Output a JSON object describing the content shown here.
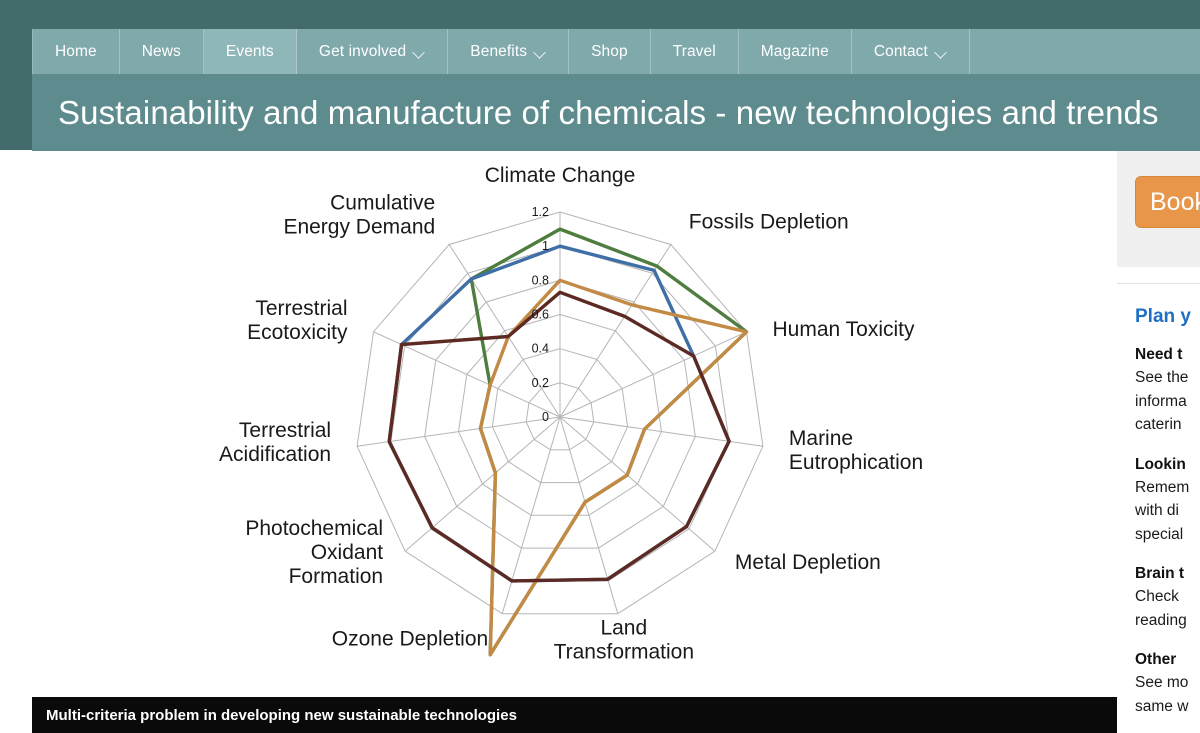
{
  "nav": {
    "items": [
      {
        "label": "Home",
        "has_dropdown": false,
        "active": false
      },
      {
        "label": "News",
        "has_dropdown": false,
        "active": false
      },
      {
        "label": "Events",
        "has_dropdown": false,
        "active": true
      },
      {
        "label": "Get involved",
        "has_dropdown": true,
        "active": false
      },
      {
        "label": "Benefits",
        "has_dropdown": true,
        "active": false
      },
      {
        "label": "Shop",
        "has_dropdown": false,
        "active": false
      },
      {
        "label": "Travel",
        "has_dropdown": false,
        "active": false
      },
      {
        "label": "Magazine",
        "has_dropdown": false,
        "active": false
      },
      {
        "label": "Contact",
        "has_dropdown": true,
        "active": false
      }
    ]
  },
  "header": {
    "title": "Sustainability and manufacture of chemicals - new technologies and trends"
  },
  "caption": {
    "text": "Multi-criteria problem in developing new sustainable technologies"
  },
  "sidebar": {
    "book_button_label": "Book",
    "card_title": "Plan y",
    "blocks": [
      {
        "heading": "Need t",
        "lines": [
          "See the",
          "informa",
          "caterin"
        ]
      },
      {
        "heading": "Lookin",
        "lines": [
          "Remem",
          "with di",
          "special"
        ]
      },
      {
        "heading": "Brain t",
        "lines": [
          "Check",
          "reading"
        ]
      },
      {
        "heading": "Other",
        "lines": [
          "See mo",
          "same w"
        ]
      }
    ]
  },
  "colors": {
    "nav_bg": "#7fa9ab",
    "nav_active_bg": "#8fb6b8",
    "title_bg": "#5e8c8e",
    "page_frame": "#436b6b",
    "caption_bg": "#0a0a0a",
    "book_button": "#e8974a",
    "link": "#2a7fd4",
    "card_title": "#1f6fc4",
    "series_green": "#4e7d3f",
    "series_blue": "#3f6fa6",
    "series_orange": "#c28a45",
    "series_brown": "#5c2a22",
    "grid": "#b5b5b5"
  },
  "chart_data": {
    "type": "radar",
    "title": "",
    "grid": true,
    "legend_position": "none",
    "rlim": [
      0,
      1.2
    ],
    "rticks": [
      "0",
      "0.2",
      "0.4",
      "0.6",
      "0.8",
      "1",
      "1.2"
    ],
    "rtick_values": [
      0,
      0.2,
      0.4,
      0.6,
      0.8,
      1.0,
      1.2
    ],
    "categories": [
      "Climate Change",
      "Fossils Depletion",
      "Human Toxicity",
      "Marine Eutrophication",
      "Metal Depletion",
      "Land Transformation",
      "Ozone Depletion",
      "Photochemical Oxidant Formation",
      "Terrestrial Acidification",
      "Terrestrial Ecotoxicity",
      "Cumulative Energy Demand"
    ],
    "series": [
      {
        "name": "series-green",
        "color": "#4e7d3f",
        "values": [
          1.1,
          1.05,
          1.2,
          0.5,
          0.52,
          0.52,
          1.45,
          0.5,
          0.47,
          0.45,
          0.96
        ]
      },
      {
        "name": "series-blue",
        "color": "#3f6fa6",
        "values": [
          1.0,
          1.02,
          0.86,
          1.0,
          0.98,
          0.99,
          1.0,
          0.99,
          1.01,
          1.02,
          0.96
        ]
      },
      {
        "name": "series-orange",
        "color": "#c28a45",
        "values": [
          0.8,
          0.78,
          1.2,
          0.5,
          0.52,
          0.52,
          1.45,
          0.5,
          0.47,
          0.45,
          0.56
        ]
      },
      {
        "name": "series-brown",
        "color": "#5c2a22",
        "values": [
          0.73,
          0.7,
          0.86,
          1.0,
          0.98,
          0.99,
          1.0,
          0.99,
          1.01,
          1.02,
          0.56
        ]
      }
    ]
  }
}
